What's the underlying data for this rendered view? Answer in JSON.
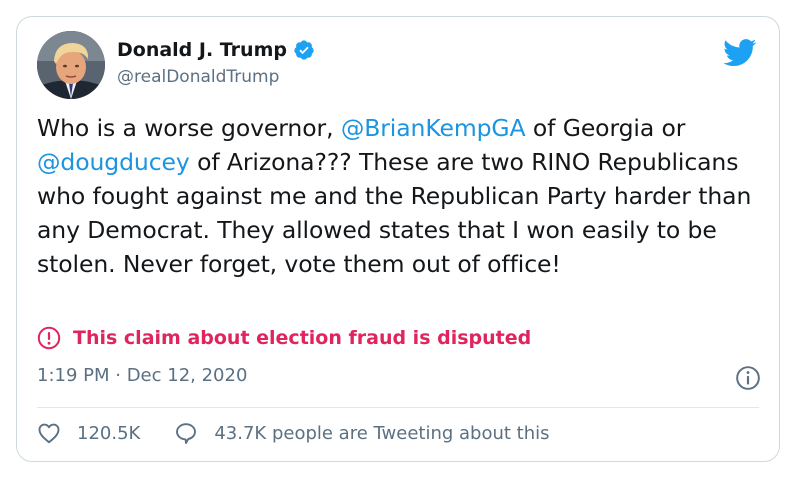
{
  "author": {
    "display_name": "Donald J. Trump",
    "handle": "@realDonaldTrump",
    "verified": true,
    "avatar_icon": "profile-photo"
  },
  "brand_icon": "twitter-bird-icon",
  "tweet": {
    "segments": [
      {
        "text": "Who is a worse governor, ",
        "type": "text"
      },
      {
        "text": "@BrianKempGA",
        "type": "mention"
      },
      {
        "text": " of Georgia or ",
        "type": "text"
      },
      {
        "text": "@dougducey",
        "type": "mention"
      },
      {
        "text": " of Arizona??? These are two RINO Republicans who fought against me and the Republican Party harder than any Democrat. They allowed states that I won easily to be stolen. Never forget, vote them out of office!",
        "type": "text"
      }
    ]
  },
  "notice": {
    "text": "This claim about election fraud is disputed",
    "icon": "exclamation-circle-icon"
  },
  "meta": {
    "timestamp": "1:19 PM · Dec 12, 2020"
  },
  "actions": {
    "likes": "120.5K",
    "tweeting": "43.7K people are Tweeting about this"
  },
  "colors": {
    "accent": "#1da1f2",
    "mention": "#1b95e0",
    "warning": "#e0245e",
    "secondary_text": "#5b7083",
    "border": "#cfd9de"
  }
}
